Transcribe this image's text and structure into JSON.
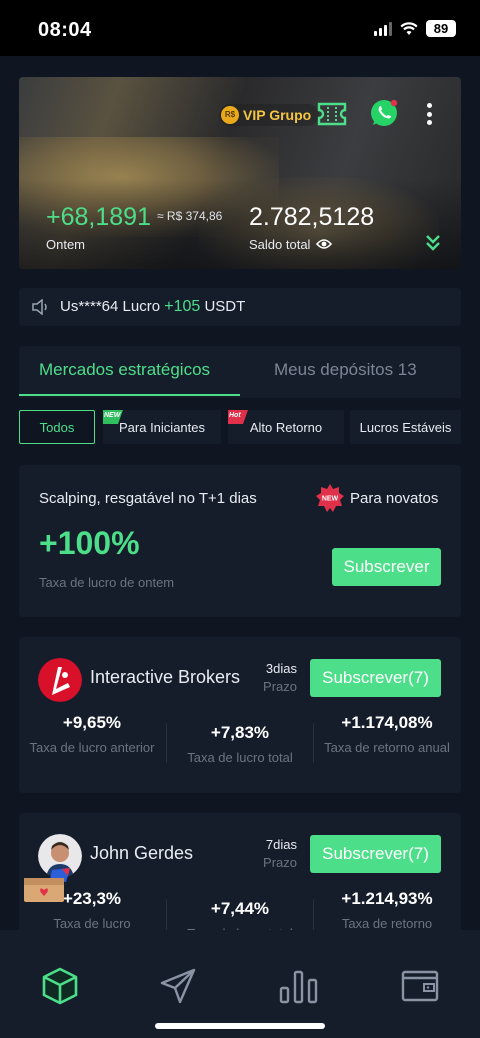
{
  "status_bar": {
    "time": "08:04",
    "battery": "89"
  },
  "hero": {
    "vip_label": "VIP Grupo",
    "vip_coin_text": "R$",
    "profit_value": "+68,1891",
    "profit_approx": "≈ R$ 374,86",
    "profit_label": "Ontem",
    "balance_value": "2.782,5128",
    "balance_label": "Saldo total"
  },
  "notice": {
    "prefix": "Us****64 Lucro ",
    "amount": "+105",
    "suffix": " USDT"
  },
  "tabs": {
    "active": "Mercados estratégicos",
    "inactive": "Meus depósitos 13"
  },
  "chips": {
    "all": "Todos",
    "beginners": "Para Iniciantes",
    "beginners_tag": "NEW",
    "high_return": "Alto Retorno",
    "high_return_tag": "Hot",
    "stable": "Lucros Estáveis"
  },
  "scalping": {
    "title": "Scalping, resgatável no T+1 dias",
    "badge_text": "NEW",
    "badge_label": "Para novatos",
    "rate": "+100%",
    "rate_label": "Taxa de lucro de ontem",
    "button": "Subscrever"
  },
  "brokers": [
    {
      "name": "Interactive Brokers",
      "days": "3dias",
      "period_label": "Prazo",
      "button": "Subscrever(7)",
      "stat1_value": "+9,65%",
      "stat1_label": "Taxa de lucro anterior",
      "stat2_value": "+7,83%",
      "stat2_label": "Taxa de lucro total",
      "stat3_value": "+1.174,08%",
      "stat3_label": "Taxa de retorno anual"
    },
    {
      "name": "John Gerdes",
      "days": "7dias",
      "period_label": "Prazo",
      "button": "Subscrever(7)",
      "stat1_value": "+23,3%",
      "stat1_label": "Taxa de lucro",
      "stat2_value": "+7,44%",
      "stat2_label": "Taxa de lucro total",
      "stat3_value": "+1.214,93%",
      "stat3_label": "Taxa de retorno"
    }
  ],
  "icons": {
    "home": "cube-icon",
    "send": "paper-plane-icon",
    "chart": "bar-chart-icon",
    "wallet": "wallet-icon"
  },
  "colors": {
    "accent": "#4dde8a",
    "background": "#0f1622",
    "card": "#161d2a",
    "hot": "#e0304a",
    "vip": "#f5c542"
  }
}
